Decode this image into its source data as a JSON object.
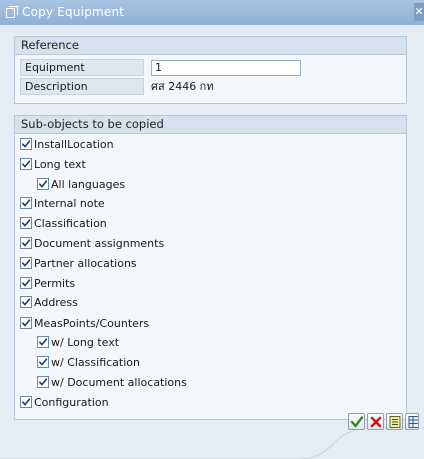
{
  "window": {
    "title": "Copy Equipment",
    "close_glyph": "✕"
  },
  "reference": {
    "header": "Reference",
    "equipment_label": "Equipment",
    "equipment_value": "1",
    "description_label": "Description",
    "description_value": "ศส 2446 กท"
  },
  "subobjects": {
    "header": "Sub-objects to be copied",
    "items": [
      {
        "label": "InstallLocation",
        "checked": true
      },
      {
        "label": "Long text",
        "checked": true
      },
      {
        "label": "All languages",
        "checked": true
      },
      {
        "label": "Internal note",
        "checked": true
      },
      {
        "label": "Classification",
        "checked": true
      },
      {
        "label": "Document assignments",
        "checked": true
      },
      {
        "label": "Partner allocations",
        "checked": true
      },
      {
        "label": "Permits",
        "checked": true
      },
      {
        "label": "Address",
        "checked": true
      },
      {
        "label": "MeasPoints/Counters",
        "checked": true
      },
      {
        "label": "w/ Long text",
        "checked": true
      },
      {
        "label": "w/ Classification",
        "checked": true
      },
      {
        "label": "w/ Document allocations",
        "checked": true
      },
      {
        "label": "Configuration",
        "checked": true
      }
    ]
  },
  "buttons": {
    "confirm_icon": "checkmark-icon",
    "cancel_icon": "cancel-icon",
    "details_icon": "details-icon",
    "more_icon": "table-icon"
  },
  "colors": {
    "check": "#1c3a73",
    "confirm": "#2e8b20",
    "cancel": "#c8181c"
  }
}
